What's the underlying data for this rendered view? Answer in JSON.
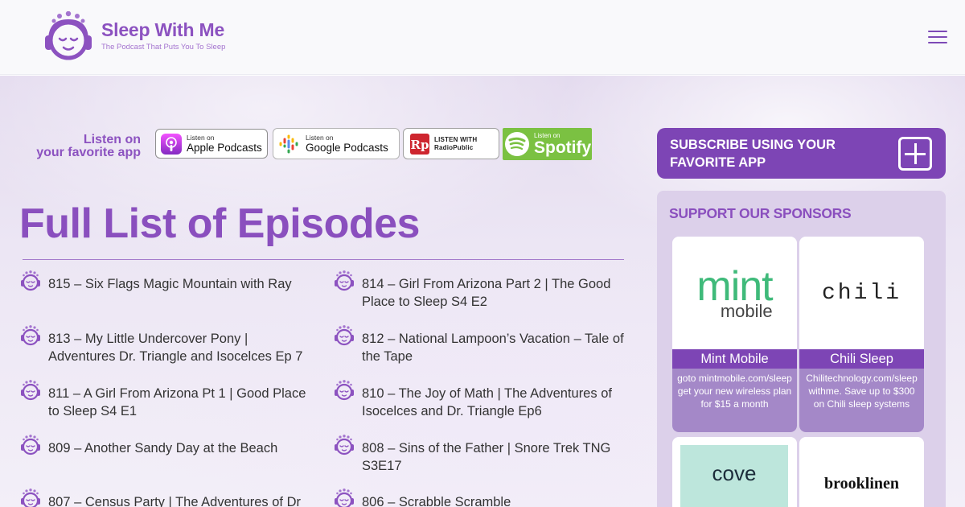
{
  "header": {
    "logo_title": "Sleep With Me",
    "logo_tagline": "The Podcast That Puts You To Sleep"
  },
  "listen": {
    "label_line1": "Listen on",
    "label_line2": "your favorite app",
    "badges": [
      {
        "small": "Listen on",
        "big": "Apple Podcasts"
      },
      {
        "small": "Listen on",
        "big": "Google Podcasts"
      },
      {
        "small": "LISTEN WITH",
        "big": "RadioPublic"
      },
      {
        "small": "Listen on",
        "big": "Spotify"
      }
    ]
  },
  "main": {
    "title": "Full List of Episodes",
    "episodes": [
      "815 – Six Flags Magic Mountain with Ray",
      "814 – Girl From Arizona Part 2 | The Good Place to Sleep S4 E2",
      "813 – My Little Undercover Pony | Adventures Dr. Triangle and Isocelces Ep 7",
      "812 – National Lampoon’s Vacation – Tale of the Tape",
      "811 – A Girl From Arizona Pt 1 | Good Place to Sleep S4 E1",
      "810 – The Joy of Math | The Adventures of Isocelces and Dr. Triangle Ep6",
      "809 – Another Sandy Day at the Beach",
      "808 – Sins of the Father | Snore Trek TNG S3E17",
      "807 – Census Party | The Adventures of Dr",
      "806 – Scrabble Scramble"
    ]
  },
  "sidebar": {
    "subscribe_label": "SUBSCRIBE USING YOUR FAVORITE APP",
    "sponsors_title": "SUPPORT OUR SPONSORS",
    "sponsors": [
      {
        "logo_text": "mint",
        "logo_sub": "mobile",
        "name": "Mint Mobile",
        "desc": "goto mintmobile.com/sleep get your new wireless plan for $15 a month"
      },
      {
        "logo_text": "chili",
        "name": "Chili Sleep",
        "desc": "Chilitechnology.com/sleepwithme. Save up to $300 on Chili sleep systems"
      },
      {
        "logo_text": "cove"
      },
      {
        "logo_text": "brooklinen"
      }
    ]
  },
  "colors": {
    "brand_purple": "#8a4fbe",
    "button_purple": "#7d45b5",
    "spotify_green": "#7bc142",
    "mint_green": "#3fba7a"
  },
  "icons": [
    "sleeping-face-headphones-icon",
    "hamburger-menu-icon",
    "plus-box-icon"
  ]
}
